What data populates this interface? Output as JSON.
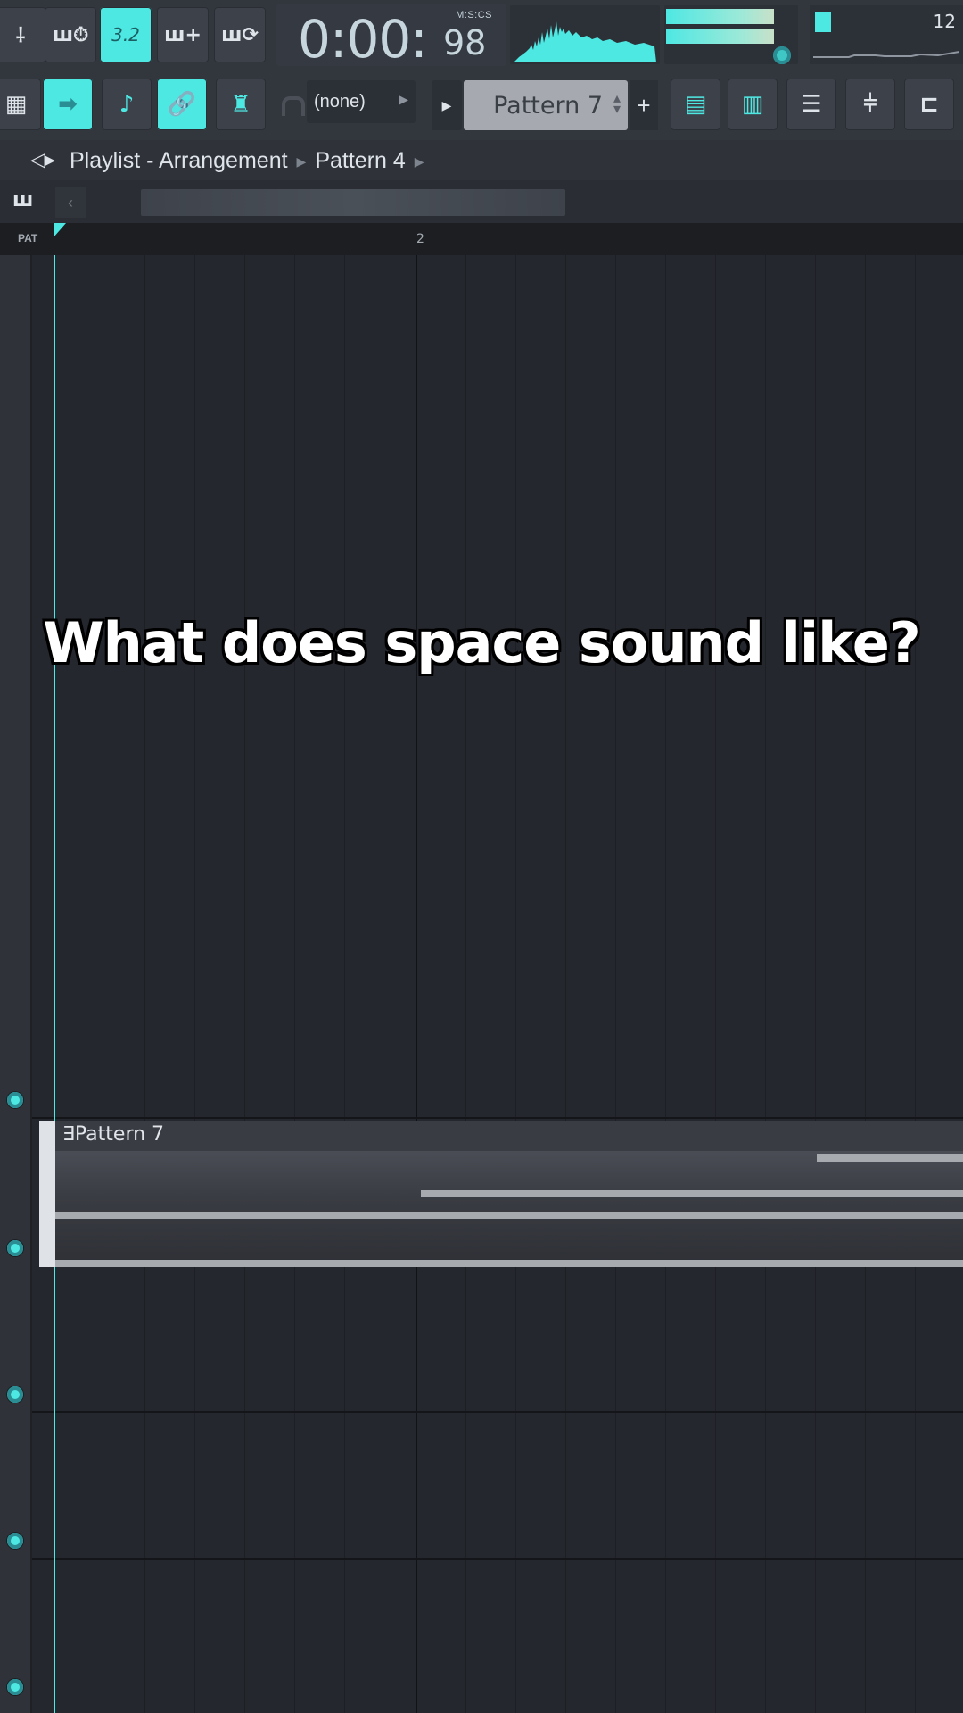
{
  "toolbar": {
    "buttons_row1": [
      {
        "label": "⸸",
        "active": false
      },
      {
        "label": "ш⏱",
        "active": false
      },
      {
        "label": "3.2",
        "active": true
      },
      {
        "label": "ш+",
        "active": false
      },
      {
        "label": "ш⟳",
        "active": false
      }
    ],
    "time": {
      "main": "0:00:",
      "cs": "98",
      "format": "M:S:CS"
    },
    "cpu_value": "12",
    "buttons_row2": [
      {
        "label": "▦",
        "active": false
      },
      {
        "label": "➡",
        "active": true
      },
      {
        "label": "♪",
        "active": false
      },
      {
        "label": "🔗",
        "active": true
      },
      {
        "label": "♜",
        "active": false
      }
    ],
    "snap_value": "(none)",
    "pattern_value": "Pattern 7",
    "pattern_add": "+",
    "right_buttons": [
      "▤",
      "▥",
      "☰",
      "⫩",
      "⊏"
    ]
  },
  "breadcrumb": {
    "items": [
      "Playlist - Arrangement",
      "Pattern 4"
    ]
  },
  "timeline": {
    "pat_label": "PAT",
    "bar_number": "2"
  },
  "clip": {
    "title": "Pattern 7"
  },
  "caption": "What does space sound like?",
  "colors": {
    "accent": "#4ee8e3",
    "background": "#26282f",
    "toolbar": "#32363d"
  }
}
